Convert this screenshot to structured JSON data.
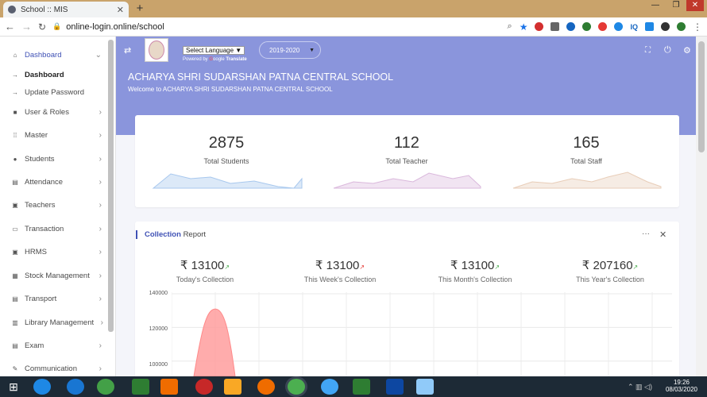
{
  "browser": {
    "tab_title": "School :: MIS",
    "url": "online-login.online/school"
  },
  "topbar": {
    "language": "Select Language",
    "powered": "Powered by",
    "translate": "Translate",
    "session": "2019-2020"
  },
  "hero": {
    "title": "ACHARYA SHRI SUDARSHAN PATNA CENTRAL SCHOOL",
    "welcome": "Welcome to ACHARYA SHRI SUDARSHAN PATNA CENTRAL SCHOOL"
  },
  "sidebar": {
    "items": [
      {
        "label": "Dashboard",
        "icon": "home-icon"
      },
      {
        "label": "Dashboard",
        "icon": "arrow-icon"
      },
      {
        "label": "Update Password",
        "icon": "arrow-icon"
      },
      {
        "label": "User & Roles",
        "icon": "lock-icon"
      },
      {
        "label": "Master",
        "icon": "grid-icon"
      },
      {
        "label": "Students",
        "icon": "user-icon"
      },
      {
        "label": "Attendance",
        "icon": "clipboard-icon"
      },
      {
        "label": "Teachers",
        "icon": "id-card-icon"
      },
      {
        "label": "Transaction",
        "icon": "card-icon"
      },
      {
        "label": "HRMS",
        "icon": "id-card-icon"
      },
      {
        "label": "Stock Management",
        "icon": "box-icon"
      },
      {
        "label": "Transport",
        "icon": "bus-icon"
      },
      {
        "label": "Library Management",
        "icon": "book-icon"
      },
      {
        "label": "Exam",
        "icon": "exam-icon"
      },
      {
        "label": "Communication",
        "icon": "chat-icon"
      }
    ]
  },
  "stats": [
    {
      "value": "2875",
      "label": "Total Students"
    },
    {
      "value": "112",
      "label": "Total Teacher"
    },
    {
      "value": "165",
      "label": "Total Staff"
    }
  ],
  "report": {
    "title_bold": "Collection",
    "title_rest": "Report"
  },
  "collections": [
    {
      "value": "₹ 13100",
      "label": "Today's Collection",
      "trend": "up"
    },
    {
      "value": "₹ 13100",
      "label": "This Week's Collection",
      "trend": "down"
    },
    {
      "value": "₹ 13100",
      "label": "This Month's Collection",
      "trend": "up"
    },
    {
      "value": "₹ 207160",
      "label": "This Year's Collection",
      "trend": "up"
    }
  ],
  "chart_data": {
    "type": "area",
    "y_ticks": [
      "140000",
      "120000",
      "100000"
    ],
    "ylim": [
      90000,
      140000
    ],
    "peak": 131000,
    "grid": true
  },
  "colors": {
    "accent": "#8a95dc",
    "up": "#4caf50",
    "down": "#e53935"
  },
  "clock": {
    "time": "19:26",
    "date": "08/03/2020"
  }
}
